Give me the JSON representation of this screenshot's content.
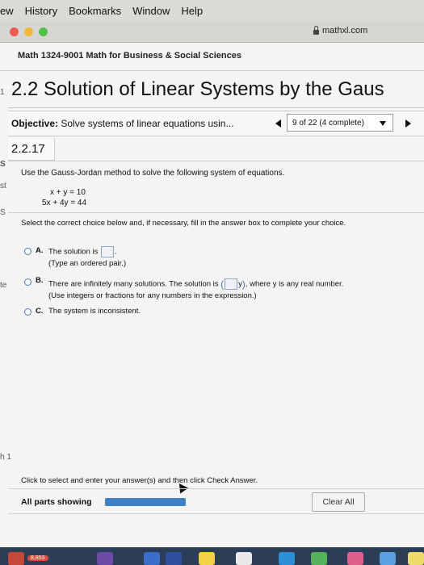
{
  "menubar": {
    "items": [
      "ew",
      "History",
      "Bookmarks",
      "Window",
      "Help"
    ]
  },
  "browser": {
    "url": "mathxl.com",
    "colors": {
      "close": "#ee5b52",
      "minimize": "#f4b73d",
      "zoom": "#4fc144"
    }
  },
  "course": {
    "title": "Math 1324-9001 Math for Business & Social Sciences"
  },
  "section": {
    "title": "2.2 Solution of Linear Systems by the Gaus"
  },
  "objective": {
    "label": "Objective:",
    "text": " Solve systems of linear equations usin..."
  },
  "navigation": {
    "progress": "9 of 22 (4 complete)"
  },
  "question": {
    "number": "2.2.17",
    "instruction": "Use the Gauss-Jordan method to solve the following system of equations.",
    "equations": [
      "x + y = 10",
      "5x + 4y = 44"
    ],
    "select_prompt": "Select the correct choice below and, if necessary, fill in the answer box to complete your choice.",
    "choices": [
      {
        "letter": "A.",
        "text_before": "The solution is",
        "text_after": ".",
        "hint": "(Type an ordered pair.)"
      },
      {
        "letter": "B.",
        "text_before": "There are infinitely many solutions. The solution is",
        "text_mid": "y",
        "text_after": ", where y is any real number.",
        "hint": "(Use integers or fractions for any numbers in the expression.)"
      },
      {
        "letter": "C.",
        "text": "The system is inconsistent."
      }
    ]
  },
  "left_edge": {
    "fragments": [
      "1",
      "S",
      "st",
      "S",
      "te",
      "h 1"
    ]
  },
  "footer": {
    "instruction": "Click to select and enter your answer(s) and then click Check Answer.",
    "all_parts": "All parts showing",
    "clear_all": "Clear All"
  },
  "dock": {
    "badge": "8,853"
  }
}
